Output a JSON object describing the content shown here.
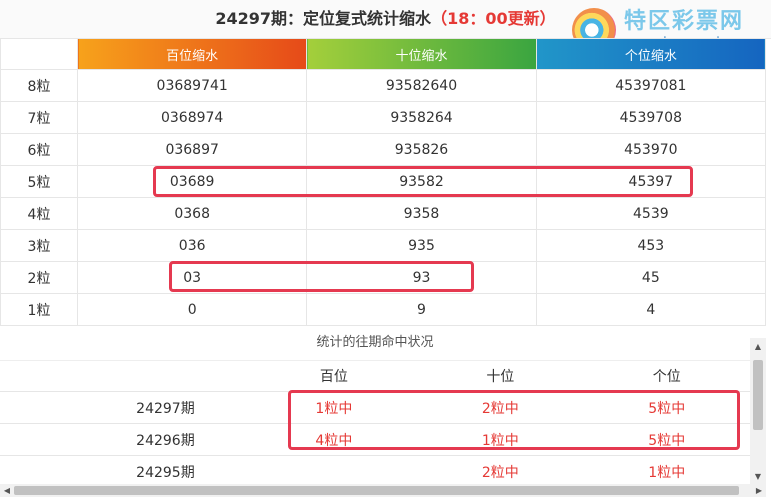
{
  "title": {
    "main": "24297期：定位复式统计缩水",
    "time": "（18：00更新）"
  },
  "logo": {
    "cn": "特区彩票网",
    "en": "www.tqcp.net"
  },
  "main_table": {
    "headers": [
      "",
      "百位缩水",
      "十位缩水",
      "个位缩水"
    ],
    "rows": [
      {
        "label": "8粒",
        "cells": [
          "03689741",
          "93582640",
          "45397081"
        ]
      },
      {
        "label": "7粒",
        "cells": [
          "0368974",
          "9358264",
          "4539708"
        ]
      },
      {
        "label": "6粒",
        "cells": [
          "036897",
          "935826",
          "453970"
        ]
      },
      {
        "label": "5粒",
        "cells": [
          "03689",
          "93582",
          "45397"
        ]
      },
      {
        "label": "4粒",
        "cells": [
          "0368",
          "9358",
          "4539"
        ]
      },
      {
        "label": "3粒",
        "cells": [
          "036",
          "935",
          "453"
        ]
      },
      {
        "label": "2粒",
        "cells": [
          "03",
          "93",
          "45"
        ]
      },
      {
        "label": "1粒",
        "cells": [
          "0",
          "9",
          "4"
        ]
      }
    ]
  },
  "history": {
    "title": "统计的往期命中状况",
    "headers": [
      "",
      "",
      "百位",
      "十位",
      "个位"
    ],
    "rows": [
      {
        "period": "24297期",
        "cells": [
          "1粒中",
          "2粒中",
          "5粒中"
        ]
      },
      {
        "period": "24296期",
        "cells": [
          "4粒中",
          "1粒中",
          "5粒中"
        ]
      },
      {
        "period": "24295期",
        "cells": [
          "",
          "2粒中",
          "1粒中"
        ]
      }
    ]
  },
  "colors": {
    "highlight": "#e53950",
    "hit_text": "#e53935",
    "hdr1": "#ee6a1d",
    "hdr2": "#6cbb3c",
    "hdr3": "#1d80c4"
  }
}
